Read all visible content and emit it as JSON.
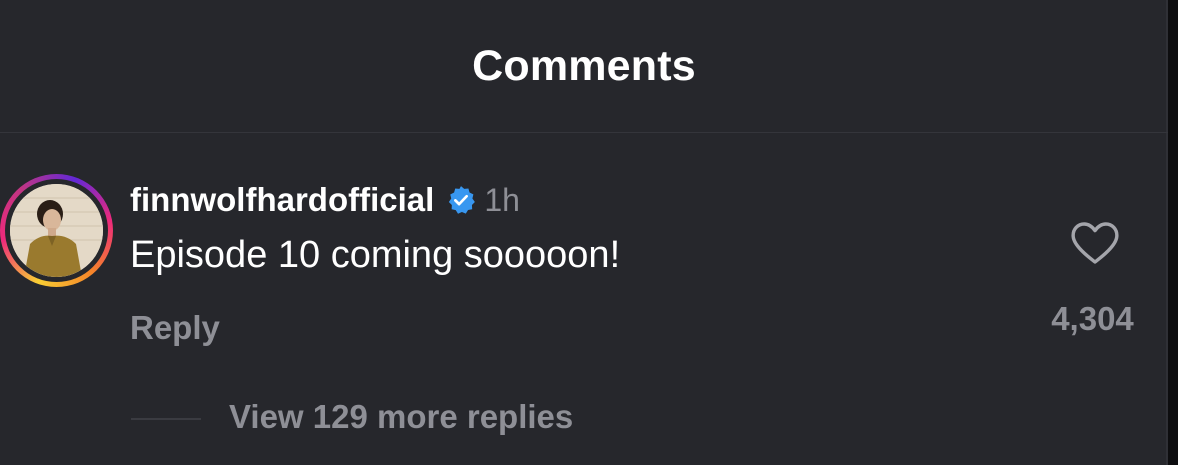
{
  "header": {
    "title": "Comments"
  },
  "comment": {
    "username": "finnwolfhardofficial",
    "verified": true,
    "time": "1h",
    "text": "Episode 10 coming sooooon!",
    "reply_label": "Reply",
    "like_count": "4,304",
    "view_replies_label": "View 129 more replies"
  },
  "icons": {
    "verified": "verified-badge-icon",
    "like": "heart-outline-icon"
  },
  "colors": {
    "background": "#26272c",
    "text_primary": "#ffffff",
    "text_secondary": "#8e8f96",
    "verified_blue": "#3897f0"
  }
}
